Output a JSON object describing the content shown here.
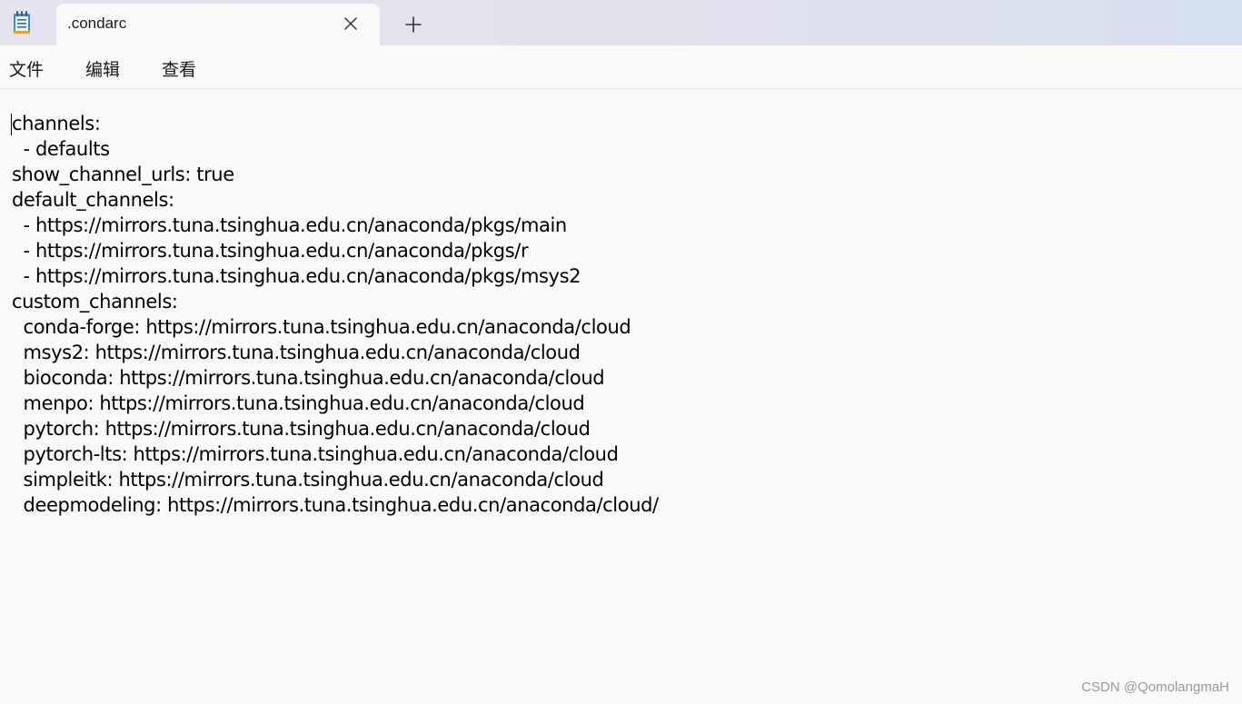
{
  "tab": {
    "title": ".condarc",
    "close_icon": "close-icon",
    "new_tab_icon": "plus-icon"
  },
  "app_icon": "notepad-icon",
  "menu": {
    "file": "文件",
    "edit": "编辑",
    "view": "查看"
  },
  "editor": {
    "content": "channels:\n  - defaults\nshow_channel_urls: true\ndefault_channels:\n  - https://mirrors.tuna.tsinghua.edu.cn/anaconda/pkgs/main\n  - https://mirrors.tuna.tsinghua.edu.cn/anaconda/pkgs/r\n  - https://mirrors.tuna.tsinghua.edu.cn/anaconda/pkgs/msys2\ncustom_channels:\n  conda-forge: https://mirrors.tuna.tsinghua.edu.cn/anaconda/cloud\n  msys2: https://mirrors.tuna.tsinghua.edu.cn/anaconda/cloud\n  bioconda: https://mirrors.tuna.tsinghua.edu.cn/anaconda/cloud\n  menpo: https://mirrors.tuna.tsinghua.edu.cn/anaconda/cloud\n  pytorch: https://mirrors.tuna.tsinghua.edu.cn/anaconda/cloud\n  pytorch-lts: https://mirrors.tuna.tsinghua.edu.cn/anaconda/cloud\n  simpleitk: https://mirrors.tuna.tsinghua.edu.cn/anaconda/cloud\n  deepmodeling: https://mirrors.tuna.tsinghua.edu.cn/anaconda/cloud/"
  },
  "watermark": "CSDN @QomolangmaH",
  "colors": {
    "background": "#f9f9f9",
    "titlebar": "#e3e2ec",
    "text": "#000000"
  }
}
